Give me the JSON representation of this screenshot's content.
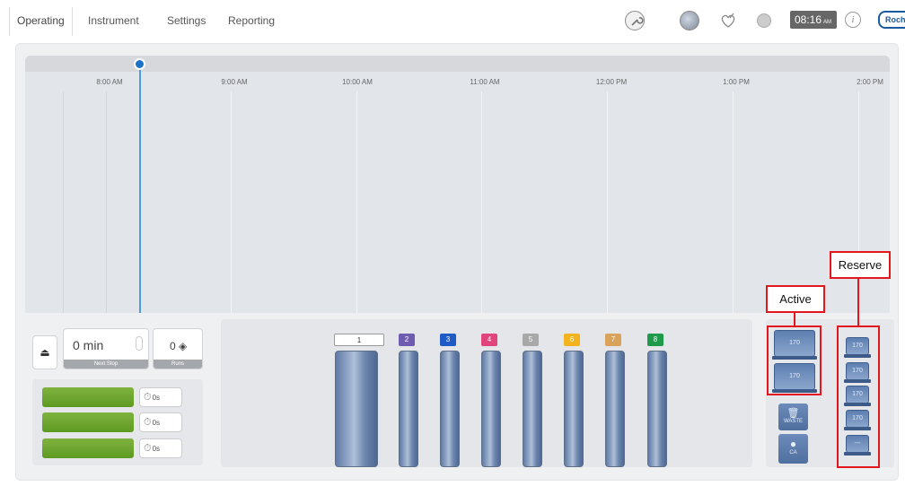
{
  "tabs": [
    "Operating",
    "Instrument",
    "Settings",
    "Reporting"
  ],
  "header": {
    "clock_time": "08:16",
    "clock_ampm": "AM",
    "info_glyph": "i",
    "logo_text": "Roche"
  },
  "timeline": {
    "ticks": [
      "8:00 AM",
      "9:00 AM",
      "10:00 AM",
      "11:00 AM",
      "12:00 PM",
      "1:00 PM",
      "2:00 PM"
    ]
  },
  "controls": {
    "eject_glyph": "⏏",
    "minutes_value": "0 min",
    "minutes_caption": "Next Stop",
    "runs_value": "0 ◈",
    "runs_caption": "Runs",
    "timers": [
      "0s",
      "0s",
      "0s"
    ]
  },
  "racks": {
    "labels": [
      "1",
      "2",
      "3",
      "4",
      "5",
      "6",
      "7",
      "8"
    ],
    "colors": [
      "#ffffff",
      "#6f5bb0",
      "#1f5bc6",
      "#e0447a",
      "#a8a8a8",
      "#f2b31c",
      "#d9a35c",
      "#1f9a4a"
    ]
  },
  "reagents": {
    "active": [
      "170",
      "170"
    ],
    "reserve": [
      "170",
      "170",
      "170",
      "170",
      "---"
    ],
    "waste_label": "WASTE",
    "ca_label": "CA"
  },
  "annotations": {
    "active": "Active",
    "reserve": "Reserve"
  }
}
